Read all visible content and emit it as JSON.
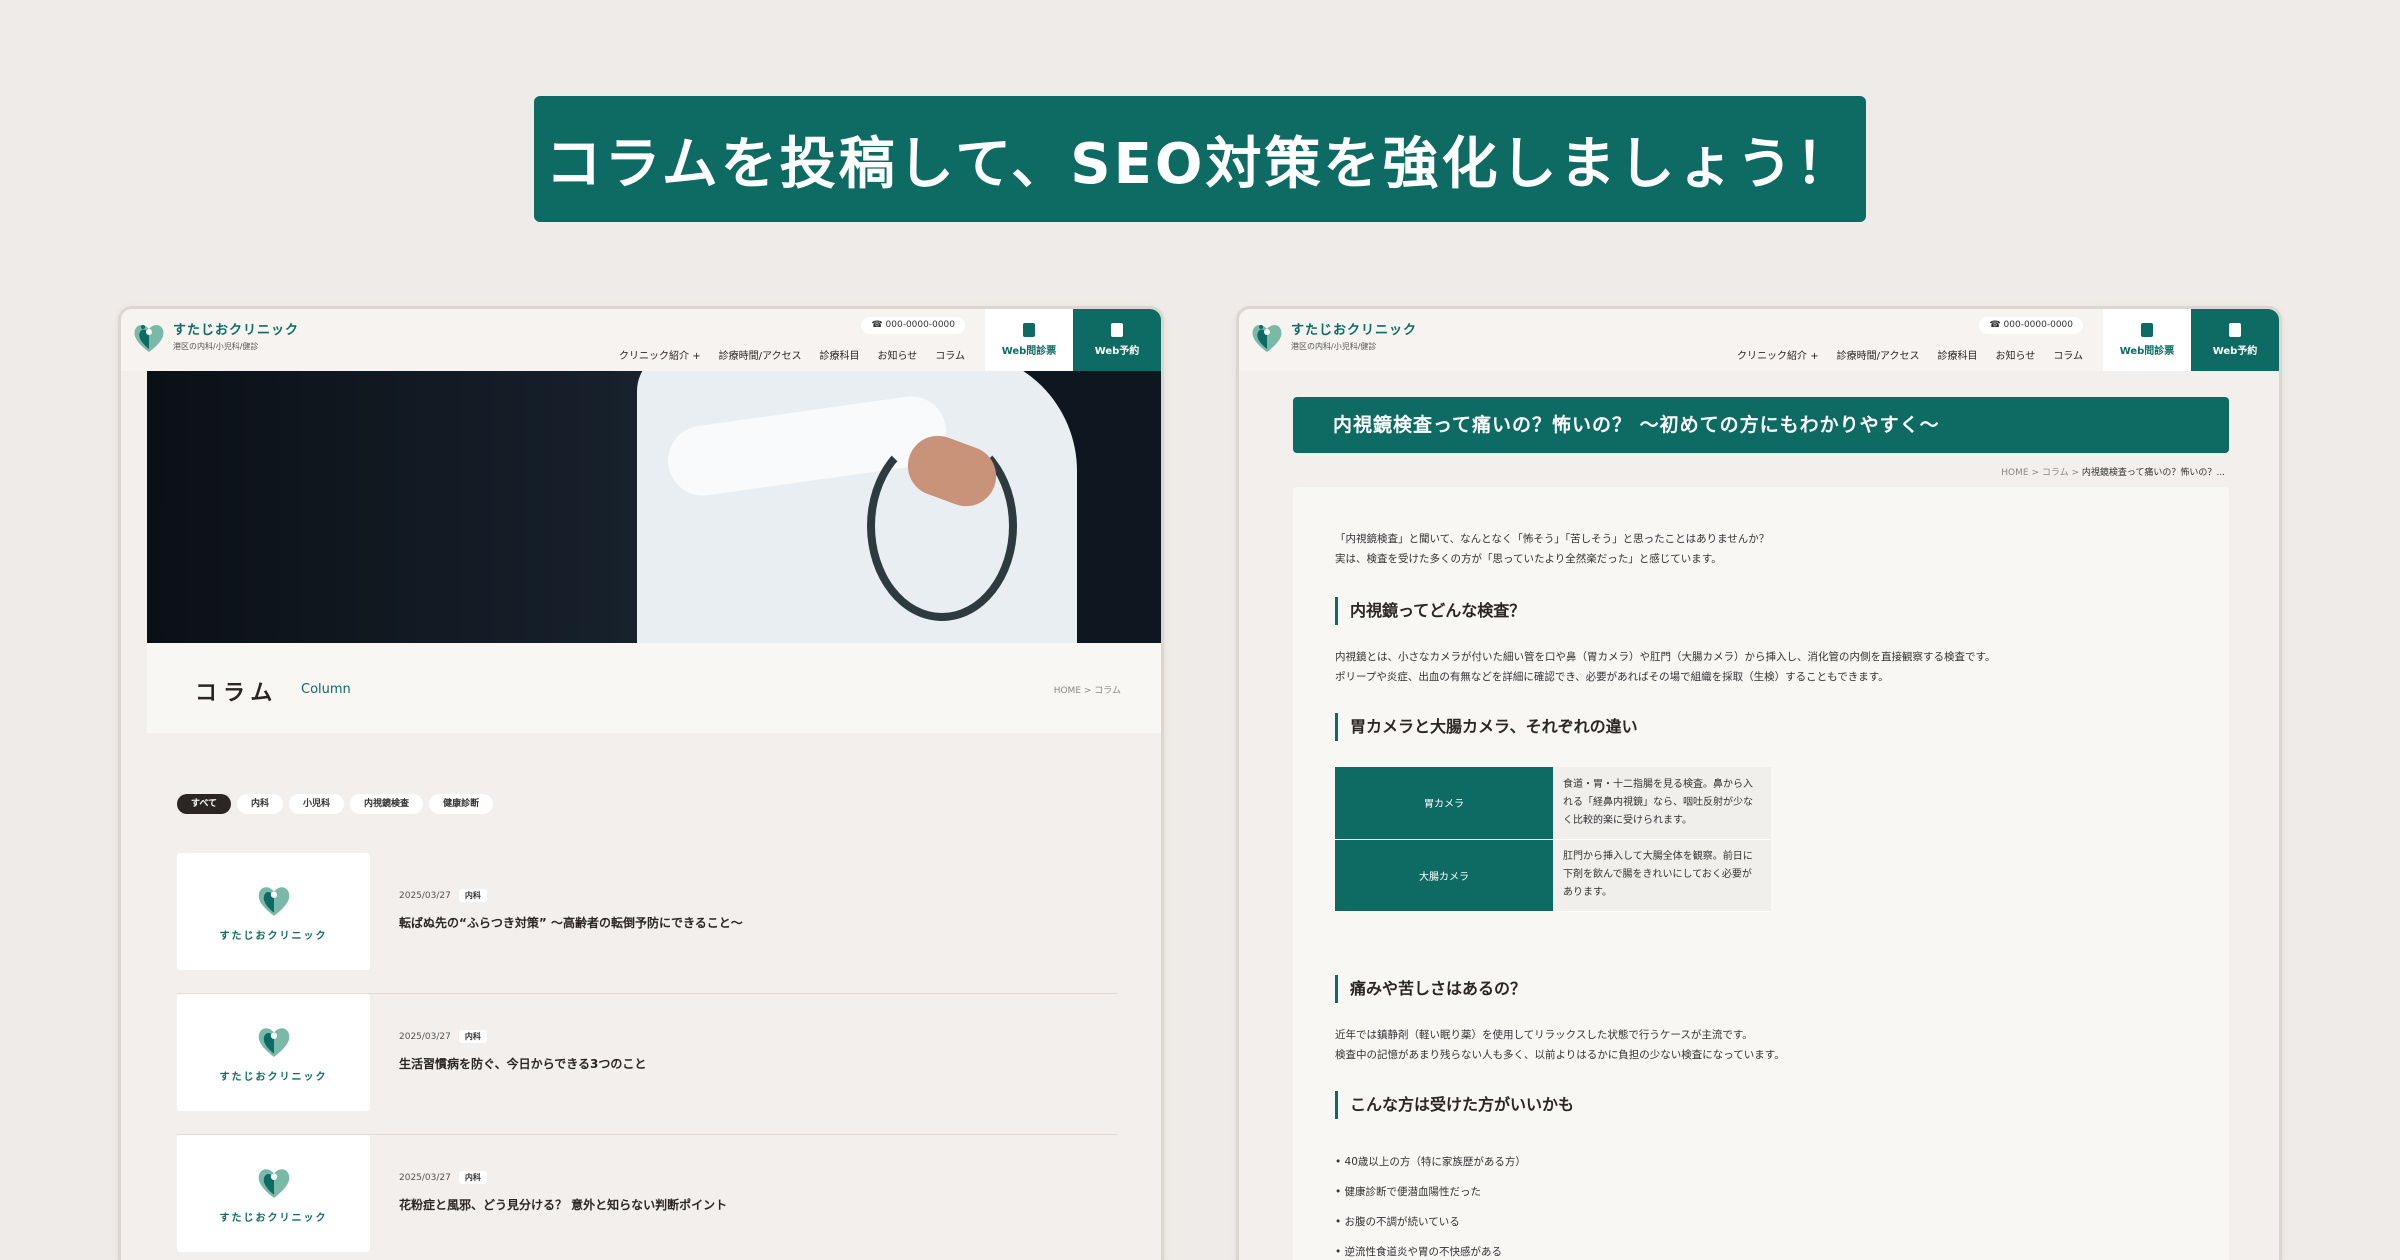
{
  "banner": {
    "text": "コラムを投稿して、SEO対策を強化しましょう！"
  },
  "clinic": {
    "name": "すたじおクリニック",
    "subtitle": "港区の内科/小児科/健診",
    "tel": "000-0000-0000",
    "nav": [
      "クリニック紹介",
      "診療時間/アクセス",
      "診療科目",
      "お知らせ",
      "コラム"
    ],
    "nav_plus": "+",
    "btn_questionnaire": "Web問診票",
    "btn_reserve": "Web予約"
  },
  "left": {
    "title": "コラム",
    "title_en": "Column",
    "breadcrumb": "HOME  >  コラム",
    "tags": [
      "すべて",
      "内科",
      "小児科",
      "内視鏡検査",
      "健康診断"
    ],
    "posts": [
      {
        "date": "2025/03/27",
        "category": "内科",
        "title": "転ばぬ先の“ふらつき対策” ～高齢者の転倒予防にできること～"
      },
      {
        "date": "2025/03/27",
        "category": "内科",
        "title": "生活習慣病を防ぐ、今日からできる3つのこと"
      },
      {
        "date": "2025/03/27",
        "category": "内科",
        "title": "花粉症と風邪、どう見分ける？ 意外と知らない判断ポイント"
      }
    ]
  },
  "right": {
    "article_title": "内視鏡検査って痛いの？怖いの？ ～初めての方にもわかりやすく～",
    "breadcrumb_home": "HOME  >  コラム  >",
    "breadcrumb_current": "内視鏡検査って痛いの？怖いの？...",
    "intro1": "「内視鏡検査」と聞いて、なんとなく「怖そう」「苦しそう」と思ったことはありませんか？",
    "intro2": "実は、検査を受けた多くの方が「思っていたより全然楽だった」と感じています。",
    "h1": "内視鏡ってどんな検査？",
    "p1a": "内視鏡とは、小さなカメラが付いた細い管を口や鼻（胃カメラ）や肛門（大腸カメラ）から挿入し、消化管の内側を直接観察する検査です。",
    "p1b": "ポリープや炎症、出血の有無などを詳細に確認でき、必要があればその場で組織を採取（生検）することもできます。",
    "h2": "胃カメラと大腸カメラ、それぞれの違い",
    "table": [
      {
        "name": "胃カメラ",
        "desc": "食道・胃・十二指腸を見る検査。鼻から入れる「経鼻内視鏡」なら、咽吐反射が少なく比較的楽に受けられます。"
      },
      {
        "name": "大腸カメラ",
        "desc": "肛門から挿入して大腸全体を観察。前日に下剤を飲んで腸をきれいにしておく必要があります。"
      }
    ],
    "h3": "痛みや苦しさはあるの？",
    "p3a": "近年では鎮静剤（軽い眠り薬）を使用してリラックスした状態で行うケースが主流です。",
    "p3b": "検査中の記憶があまり残らない人も多く、以前よりはるかに負担の少ない検査になっています。",
    "h4": "こんな方は受けた方がいいかも",
    "list": [
      "40歳以上の方（特に家族歴がある方）",
      "健康診断で便潜血陽性だった",
      "お腹の不調が続いている",
      "逆流性食道炎や胃の不快感がある"
    ]
  },
  "colors": {
    "brand": "#0d6b64",
    "background": "#efebe8"
  }
}
